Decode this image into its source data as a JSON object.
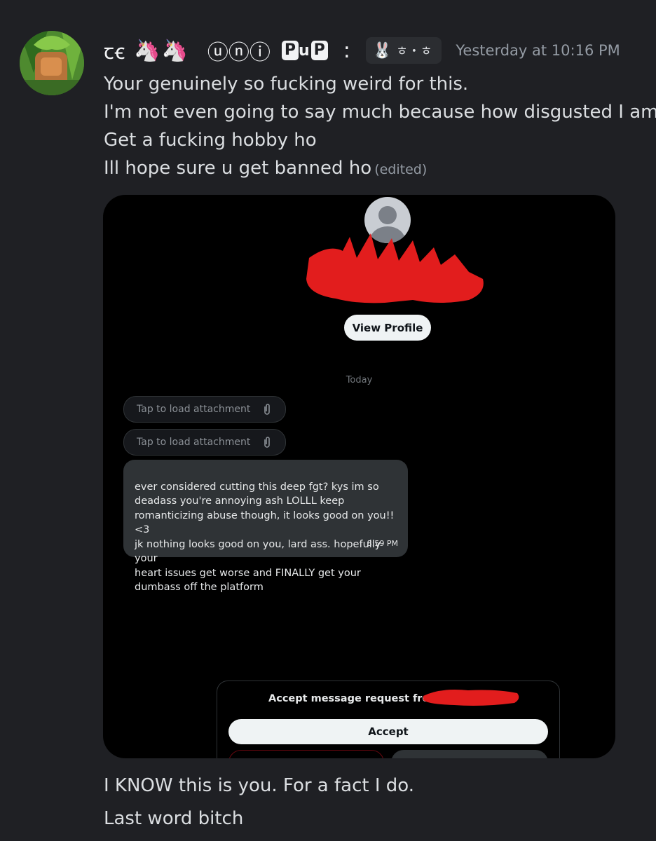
{
  "message": {
    "username_glyph": "ꞇꞓ",
    "username_emojis": [
      "🦄",
      "🦄"
    ],
    "username_circled": "ⓤⓝⓘ",
    "username_badge_1": "P",
    "username_badge_mid": "u",
    "username_badge_2": "P",
    "username_colon": ":",
    "tag_emoji": "🐰",
    "tag_text": "ㅎ・ㅎ",
    "timestamp": "Yesterday at 10:16 PM",
    "lines": [
      "Your genuinely so fucking weird for this.",
      "I'm not even going to say much because how disgusted I am.",
      "Get a fucking hobby ho",
      "Ill hope sure u get banned ho"
    ],
    "edited_label": "(edited)",
    "after_lines": [
      "I KNOW this is you. For a fact I do.",
      "Last word bitch"
    ]
  },
  "screenshot": {
    "view_profile_label": "View Profile",
    "date_divider": "Today",
    "attachments": [
      "Tap to load attachment",
      "Tap to load attachment"
    ],
    "dm_text": "ever considered cutting this deep fgt? kys im so\ndeadass you're annoying ash LOLLL keep\nromanticizing abuse though, it looks good on you!! <3\njk nothing looks good on you, lard ass. hopefully your\nheart issues get worse and FINALLY get your\ndumbass off the platform",
    "dm_time": "8:59 PM",
    "request_text": "Accept message request from",
    "accept_label": "Accept"
  },
  "colors": {
    "background": "#1f2024",
    "text": "#dbdee1",
    "muted": "#949ba4",
    "redaction": "#e21d1d"
  }
}
